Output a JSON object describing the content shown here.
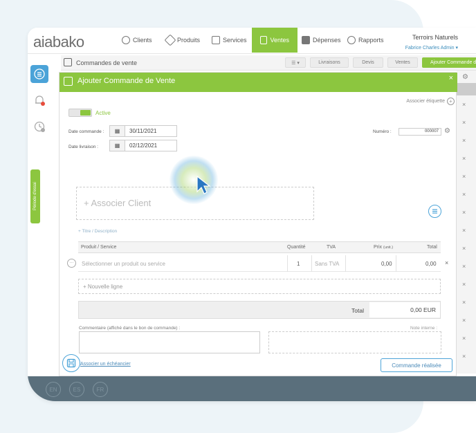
{
  "nav": {
    "logo": "aiabako",
    "items": [
      {
        "label": "Clients",
        "icon": "person-icon"
      },
      {
        "label": "Produits",
        "icon": "tag-icon"
      },
      {
        "label": "Services",
        "icon": "briefcase-icon"
      },
      {
        "label": "Ventes",
        "icon": "invoice-icon",
        "active": true
      },
      {
        "label": "Dépenses",
        "icon": "receipt-icon"
      },
      {
        "label": "Rapports",
        "icon": "chart-icon"
      }
    ],
    "company": "Terroirs Naturels",
    "user": "Fabrice Charles Admin ▾"
  },
  "subbar": {
    "title": "Commandes de vente",
    "list_btn": "☰ ▾",
    "livraisons": "Livraisons",
    "devis": "Devis",
    "ventes": "Ventes",
    "add_btn": "Ajouter Commande de Vente"
  },
  "sidebar": {
    "menu_icon": "menu-icon",
    "bell_icon": "bell-icon",
    "history_icon": "history-icon",
    "vertical_tab": "Période d'essai"
  },
  "modal": {
    "title": "Ajouter Commande de Vente",
    "close": "×",
    "assoc_tag": "Associer étiquette",
    "status": "Active",
    "date_commande_label": "Date commande :",
    "date_commande": "30/11/2021",
    "date_livraison_label": "Date livraison :",
    "date_livraison": "02/12/2021",
    "numero_label": "Numéro :",
    "numero": "000007",
    "client_link": "+ Associer Client",
    "titre_link": "+ Titre / Description",
    "table": {
      "headers": [
        "Produit / Service",
        "Quantité",
        "TVA",
        "Prix",
        "(unit.)",
        "Total"
      ],
      "row": {
        "product": "Sélectionner un produit ou service",
        "qty": "1",
        "tva": "Sans TVA",
        "price": "0,00",
        "total": "0,00"
      }
    },
    "new_line": "+ Nouvelle ligne",
    "total_label": "Total",
    "total_value": "0,00 EUR",
    "comment_label": "Commentaire (affiché dans le bon de commande) :",
    "note_label": "Note interne :",
    "sched_link": "Associer un échéancier",
    "done_btn": "Commande réalisée"
  },
  "footer": {
    "langs": [
      "EN",
      "ES",
      "FR"
    ]
  },
  "colors": {
    "green": "#8cc63f",
    "blue": "#4ba3d8",
    "footer": "#5a6f7c"
  }
}
